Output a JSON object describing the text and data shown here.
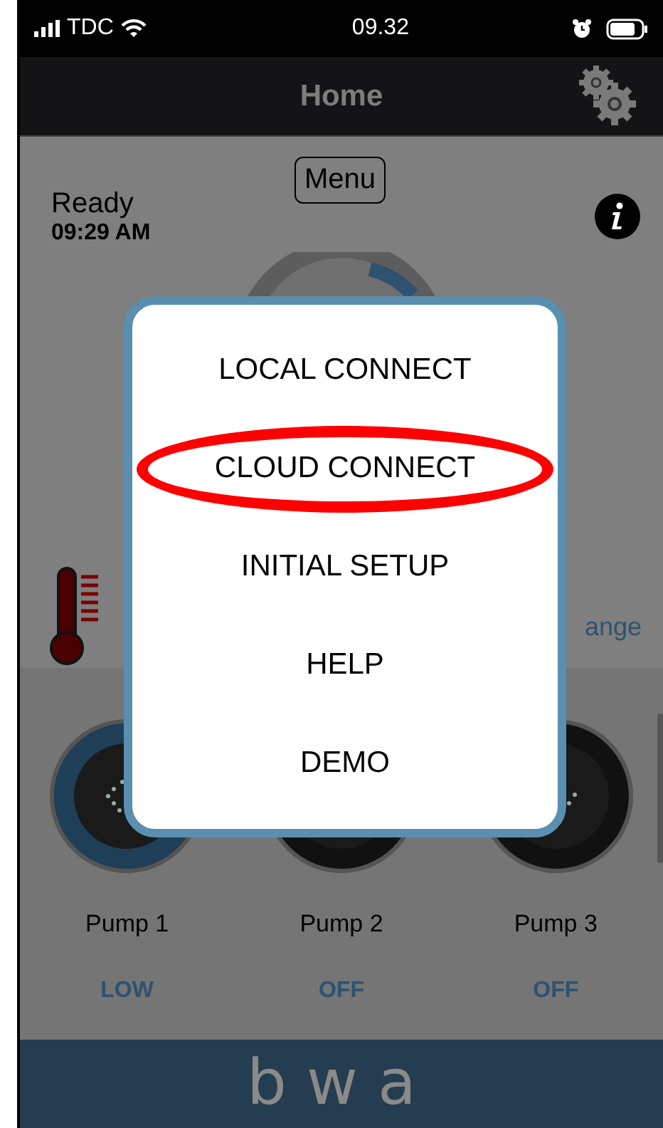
{
  "status_bar": {
    "carrier": "TDC",
    "time": "09.32"
  },
  "nav": {
    "title": "Home"
  },
  "header": {
    "state": "Ready",
    "time": "09:29 AM",
    "menu_button": "Menu"
  },
  "range_label": "ange",
  "pumps": [
    {
      "name": "Pump 1",
      "status": "LOW",
      "on": true
    },
    {
      "name": "Pump 2",
      "status": "OFF",
      "on": false
    },
    {
      "name": "Pump 3",
      "status": "OFF",
      "on": false
    }
  ],
  "footer": {
    "logo": "bwa"
  },
  "dialog": {
    "items": [
      {
        "label": "LOCAL CONNECT",
        "highlighted": false
      },
      {
        "label": "CLOUD CONNECT",
        "highlighted": true
      },
      {
        "label": "INITIAL SETUP",
        "highlighted": false
      },
      {
        "label": "HELP",
        "highlighted": false
      },
      {
        "label": "DEMO",
        "highlighted": false
      }
    ]
  }
}
